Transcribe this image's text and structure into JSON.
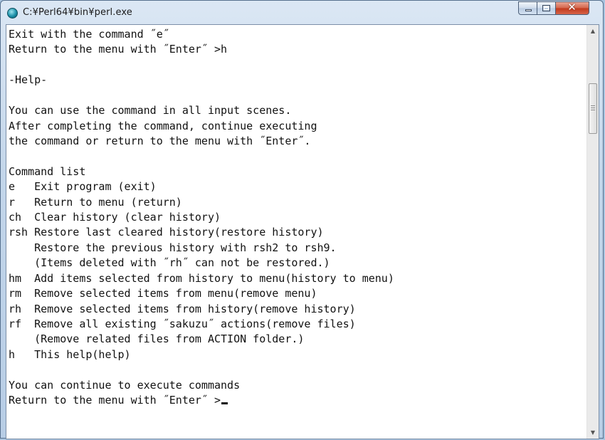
{
  "window": {
    "title": "C:¥Perl64¥bin¥perl.exe",
    "icon": "app-icon",
    "controls": {
      "minimize": "minimize-icon",
      "maximize": "maximize-icon",
      "close": "✕"
    }
  },
  "console": {
    "lines": [
      "Exit with the command ˝e˝",
      "Return to the menu with ˝Enter˝ >h",
      "",
      "-Help-",
      "",
      "You can use the command in all input scenes.",
      "After completing the command, continue executing",
      "the command or return to the menu with ˝Enter˝.",
      "",
      "Command list",
      "e   Exit program (exit)",
      "r   Return to menu (return)",
      "ch  Clear history (clear history)",
      "rsh Restore last cleared history(restore history)",
      "    Restore the previous history with rsh2 to rsh9.",
      "    (Items deleted with ˝rh˝ can not be restored.)",
      "hm  Add items selected from history to menu(history to menu)",
      "rm  Remove selected items from menu(remove menu)",
      "rh  Remove selected items from history(remove history)",
      "rf  Remove all existing ˝sakuzu˝ actions(remove files)",
      "    (Remove related files from ACTION folder.)",
      "h   This help(help)",
      "",
      "You can continue to execute commands",
      "Return to the menu with ˝Enter˝ >"
    ]
  },
  "scrollbar": {
    "up_icon": "scroll-up-arrow-icon",
    "down_icon": "scroll-down-arrow-icon",
    "position_fraction": 0.15
  }
}
